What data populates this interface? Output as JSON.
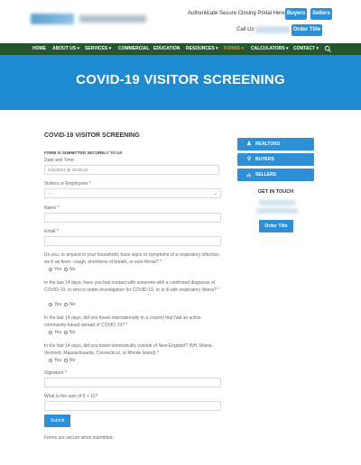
{
  "header": {
    "auth_text": "Authenticate Secure Closing Portal Here",
    "buyers_btn": "Buyers",
    "sellers_btn": "Sellers",
    "call_us": "Call Us:",
    "order_title_btn": "Order Title"
  },
  "nav": {
    "items": [
      "HOME",
      "ABOUT US",
      "SERVICES",
      "COMMERCIAL",
      "EDUCATION",
      "RESOURCES",
      "FORMS",
      "CALCULATORS",
      "CONTACT"
    ],
    "carets": [
      "",
      "▾",
      "▾",
      "",
      "",
      "▾",
      "▾",
      "▾",
      "▾"
    ],
    "active": "FORMS"
  },
  "hero": {
    "title": "COVID-19 VISITOR SCREENING"
  },
  "form": {
    "title": "COVID-19 VISITOR SCREENING",
    "secure_note": "FORM IS SUBMITTED SECURELY TO US",
    "date_label": "Date and Time:",
    "date_value": "2/11/2021 @ 15:48:22",
    "visitor_label": "Visitors or Employees *",
    "visitor_value": "---",
    "name_label": "Name *",
    "email_label": "Email *",
    "q1": "Do you, or anyone in your household, have signs or symptoms of a respiratory infection, such as fever, cough, shortness of breath, or sore throat? *",
    "q2": "In the last 14 days, have you had contact with someone with a confirmed diagnosis of COVID-19, or who is under investigation for COVID-19, or is ill with respiratory illness? *",
    "q3": "In the last 14 days, did you travel internationally to a country that had an active community-based spread of COVID-19? *",
    "q4": "In the last 14 days, did you travel domestically outside of New England? (NH, Maine, Vermont, Massachusetts, Connecticut, or Rhode Island) *",
    "yes": "Yes",
    "no": "No",
    "signature_label": "Signature *",
    "sum_label": "What is the sum of 6 + 11?",
    "submit": "Submit",
    "footer_note": "Forms are secure when submitted."
  },
  "sidebar": {
    "buttons": [
      {
        "label": "REALTORS",
        "icon": "user-tie-icon"
      },
      {
        "label": "BUYERS",
        "icon": "key-icon"
      },
      {
        "label": "SELLERS",
        "icon": "bank-icon"
      }
    ],
    "get_in_touch": "GET IN TOUCH",
    "order_title": "Order Title"
  },
  "colors": {
    "accent_blue": "#2d8fd5",
    "nav_green": "#25572f",
    "hero_blue": "#1f8ad0",
    "nav_active": "#e69540"
  }
}
